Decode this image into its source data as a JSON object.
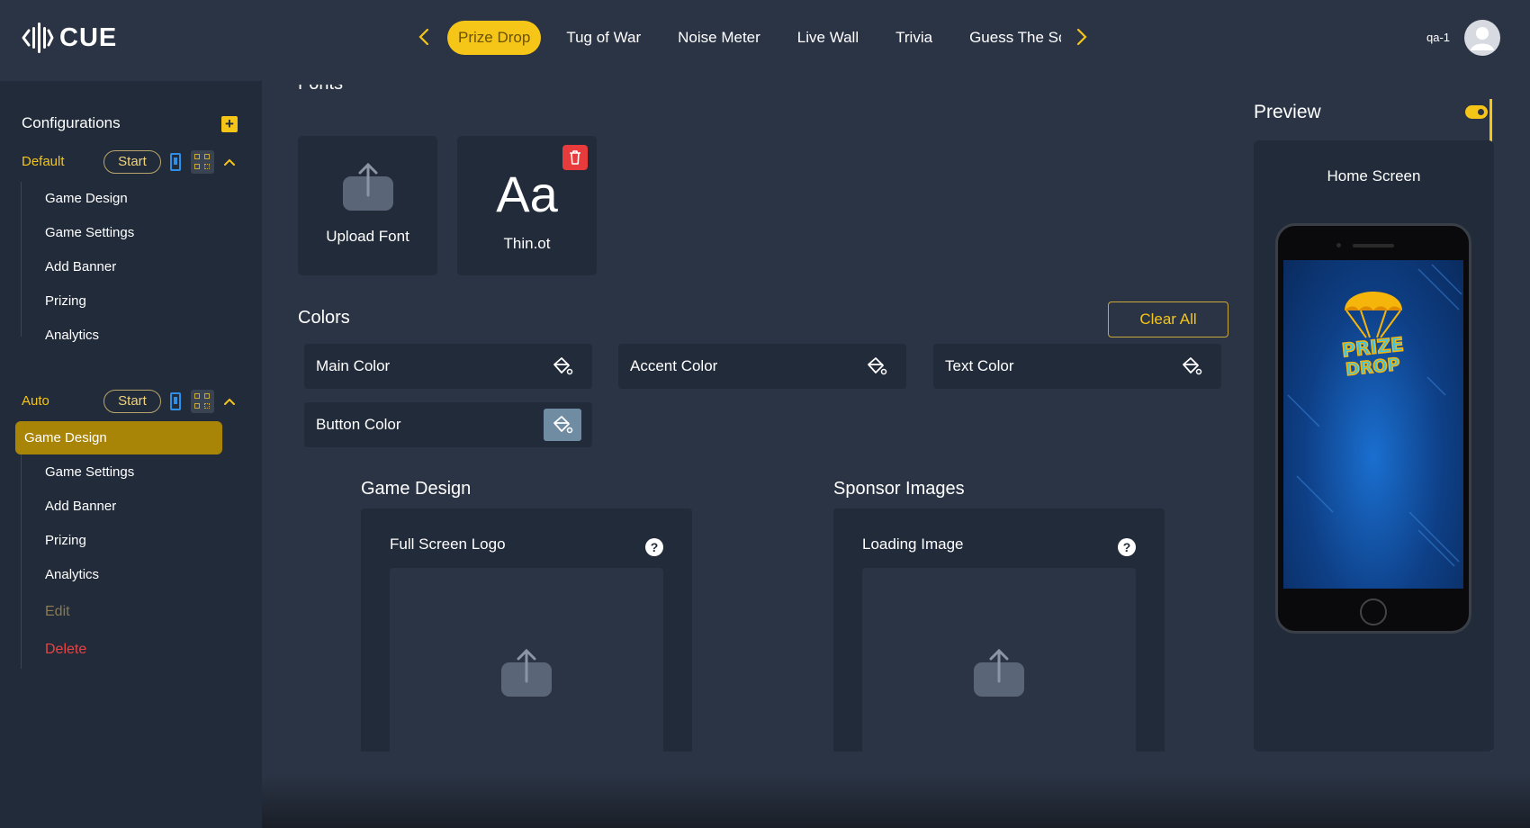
{
  "brand": {
    "name": "CUE"
  },
  "header": {
    "tabs": [
      {
        "label": "Prize Drop",
        "active": true
      },
      {
        "label": "Tug of War"
      },
      {
        "label": "Noise Meter"
      },
      {
        "label": "Live Wall"
      },
      {
        "label": "Trivia"
      },
      {
        "label": "Guess The Sc"
      }
    ],
    "user_name": "qa-1"
  },
  "sidebar": {
    "title": "Configurations",
    "groups": [
      {
        "name": "Default",
        "start_label": "Start",
        "items": [
          "Game Design",
          "Game Settings",
          "Add Banner",
          "Prizing",
          "Analytics"
        ]
      },
      {
        "name": "Auto",
        "start_label": "Start",
        "items": [
          "Game Design",
          "Game Settings",
          "Add Banner",
          "Prizing",
          "Analytics"
        ],
        "active_item": "Game Design",
        "edit_label": "Edit",
        "delete_label": "Delete"
      }
    ]
  },
  "main": {
    "fonts_title": "Fonts",
    "upload_font_label": "Upload Font",
    "font_preview_glyph": "Aa",
    "font_file_name": "Thin.ot",
    "colors_title": "Colors",
    "clear_all_label": "Clear All",
    "color_fields": [
      "Main Color",
      "Accent Color",
      "Text Color",
      "Button Color"
    ],
    "game_design_title": "Game Design",
    "sponsor_images_title": "Sponsor Images",
    "full_screen_logo_label": "Full Screen Logo",
    "loading_image_label": "Loading Image"
  },
  "preview": {
    "title": "Preview",
    "toggle_on": true,
    "screen_label": "Home Screen",
    "logo_text_line1": "PRIZE",
    "logo_text_line2": "DROP"
  },
  "colors": {
    "accent": "#f5c518",
    "active_item_bg": "#a98507",
    "delete_red": "#e84343",
    "bg": "#2b3445",
    "panel": "#222b3a"
  }
}
